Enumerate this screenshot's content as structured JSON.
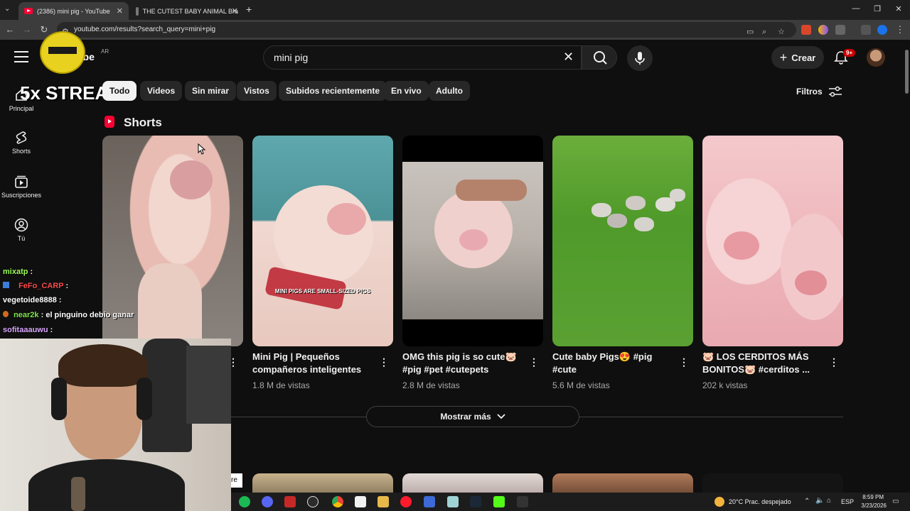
{
  "browser": {
    "tabs": [
      {
        "title": "(2386) mini pig - YouTube",
        "active": true
      },
      {
        "title": "THE CUTEST BABY ANIMAL Bra",
        "active": false
      }
    ],
    "new_tab": "+",
    "url": "youtube.com/results?search_query=mini+pig"
  },
  "youtube": {
    "logo_text": "ube",
    "country": "AR",
    "search": {
      "query": "mini pig"
    },
    "create_label": "Crear",
    "notifications_badge": "9+",
    "sidebar": [
      {
        "label": "Principal",
        "icon": "home-icon"
      },
      {
        "label": "Shorts",
        "icon": "shorts-icon"
      },
      {
        "label": "Suscripciones",
        "icon": "subscriptions-icon"
      },
      {
        "label": "Tú",
        "icon": "you-icon"
      }
    ],
    "chips": [
      {
        "label": "Todo",
        "active": true
      },
      {
        "label": "Videos",
        "active": false
      },
      {
        "label": "Sin mirar",
        "active": false
      },
      {
        "label": "Vistos",
        "active": false
      },
      {
        "label": "Subidos recientemente",
        "active": false
      },
      {
        "label": "En vivo",
        "active": false
      },
      {
        "label": "Adulto",
        "active": false
      }
    ],
    "filters_label": "Filtros",
    "shorts_heading": "Shorts",
    "shorts": [
      {
        "title": "",
        "views": "",
        "overlay": ""
      },
      {
        "title": "Mini Pig | Pequeños compañeros inteligentes",
        "views": "1.8 M de vistas",
        "overlay": "MINI PIGS ARE SMALL-SIZED PIGS"
      },
      {
        "title": "OMG this pig is so cute🐷 #pig #pet #cutepets",
        "views": "2.8 M de vistas",
        "overlay": ""
      },
      {
        "title": "Cute baby Pigs😍 #pig #cute",
        "views": "5.6 M de vistas",
        "overlay": ""
      },
      {
        "title": "🐷 LOS CERDITOS MÁS BONITOS🐷 #cerditos ...",
        "views": "202 k vistas",
        "overlay": ""
      }
    ],
    "show_more": "Mostrar más"
  },
  "stream_overlay": {
    "streak": "5x STREAK",
    "chat": [
      {
        "user": "mixatp",
        "message": ":"
      },
      {
        "user": "FeFo_CARP",
        "message": ":"
      },
      {
        "user": "vegetoide8888",
        "message": ":"
      },
      {
        "user": "near2k",
        "message": ": el pinguino debio ganar"
      },
      {
        "user": "sofitaaauwu",
        "message": ":"
      }
    ],
    "cam_edge_label": "re"
  },
  "taskbar": {
    "weather": "20°C  Prac. despejado",
    "language": "ESP",
    "time": "8:59 PM",
    "date": "3/23/2026"
  },
  "colors": {
    "background": "#0f0f0f",
    "accent_red": "#ff0033",
    "chip_bg": "#272727",
    "chat_user": "#9cff5a"
  }
}
